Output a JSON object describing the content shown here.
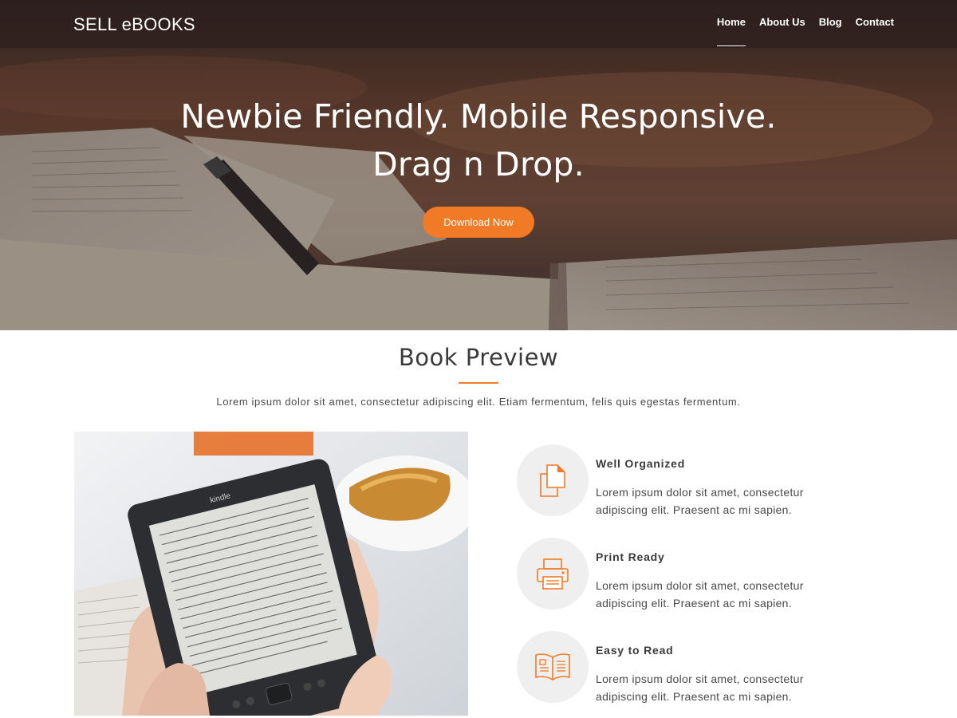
{
  "header": {
    "brand": "SELL eBOOKS",
    "nav": [
      {
        "label": "Home",
        "active": true
      },
      {
        "label": "About Us",
        "active": false
      },
      {
        "label": "Blog",
        "active": false
      },
      {
        "label": "Contact",
        "active": false
      }
    ]
  },
  "hero": {
    "title_line1": "Newbie Friendly. Mobile Responsive.",
    "title_line2": "Drag n Drop.",
    "cta_label": "Download Now",
    "background_image": "open-book-with-pen-photo"
  },
  "section": {
    "title": "Book Preview",
    "subtitle": "Lorem ipsum dolor sit amet, consectetur adipiscing elit. Etiam fermentum, felis quis egestas fermentum.",
    "photo": "hands-holding-kindle-photo",
    "photo_label": "kindle",
    "features": [
      {
        "title": "Well Organized",
        "text": "Lorem ipsum dolor sit amet, consectetur adipiscing elit. Praesent ac mi sapien.",
        "icon": "documents-icon"
      },
      {
        "title": "Print Ready",
        "text": "Lorem ipsum dolor sit amet, consectetur adipiscing elit. Praesent ac mi sapien.",
        "icon": "printer-icon"
      },
      {
        "title": "Easy to Read",
        "text": "Lorem ipsum dolor sit amet, consectetur adipiscing elit. Praesent ac mi sapien.",
        "icon": "open-book-icon"
      }
    ]
  },
  "colors": {
    "accent": "#f07a25",
    "text": "#3a3a3a",
    "icon_circle": "#efefef"
  }
}
